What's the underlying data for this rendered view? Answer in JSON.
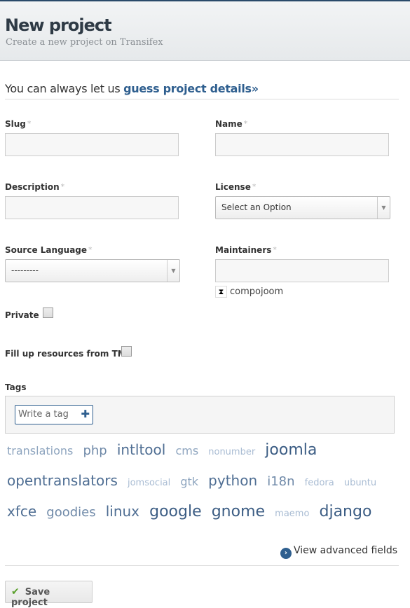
{
  "header": {
    "title": "New project",
    "subtitle": "Create a new project on Transifex"
  },
  "guess": {
    "prefix": "You can always let us ",
    "link": "guess project details»"
  },
  "fields": {
    "slug": {
      "label": "Slug",
      "value": ""
    },
    "name": {
      "label": "Name",
      "value": ""
    },
    "description": {
      "label": "Description",
      "value": ""
    },
    "license": {
      "label": "License",
      "value": "Select an Option"
    },
    "source_language": {
      "label": "Source Language",
      "value": "---------"
    },
    "maintainers": {
      "label": "Maintainers",
      "value": "",
      "chips": [
        "compojoom"
      ]
    },
    "private": {
      "label": "Private",
      "checked": false
    },
    "fill_tm": {
      "label": "Fill up resources from TM",
      "checked": false
    },
    "tags": {
      "label": "Tags",
      "placeholder": "Write a tag"
    }
  },
  "required_mark": "*",
  "tag_cloud": [
    {
      "name": "translations",
      "weight": 2
    },
    {
      "name": "php",
      "weight": 3
    },
    {
      "name": "intltool",
      "weight": 4
    },
    {
      "name": "cms",
      "weight": 2
    },
    {
      "name": "nonumber",
      "weight": 1
    },
    {
      "name": "joomla",
      "weight": 5
    },
    {
      "name": "opentranslators",
      "weight": 4
    },
    {
      "name": "jomsocial",
      "weight": 1
    },
    {
      "name": "gtk",
      "weight": 2
    },
    {
      "name": "python",
      "weight": 4
    },
    {
      "name": "i18n",
      "weight": 3
    },
    {
      "name": "fedora",
      "weight": 1
    },
    {
      "name": "ubuntu",
      "weight": 1
    },
    {
      "name": "xfce",
      "weight": 4
    },
    {
      "name": "goodies",
      "weight": 3
    },
    {
      "name": "linux",
      "weight": 4
    },
    {
      "name": "google",
      "weight": 5
    },
    {
      "name": "gnome",
      "weight": 5
    },
    {
      "name": "maemo",
      "weight": 1
    },
    {
      "name": "django",
      "weight": 5
    }
  ],
  "advanced_label": "View advanced fields",
  "save_label": "Save project",
  "colors": {
    "accent": "#2f5f8f",
    "check": "#5aa02c"
  }
}
